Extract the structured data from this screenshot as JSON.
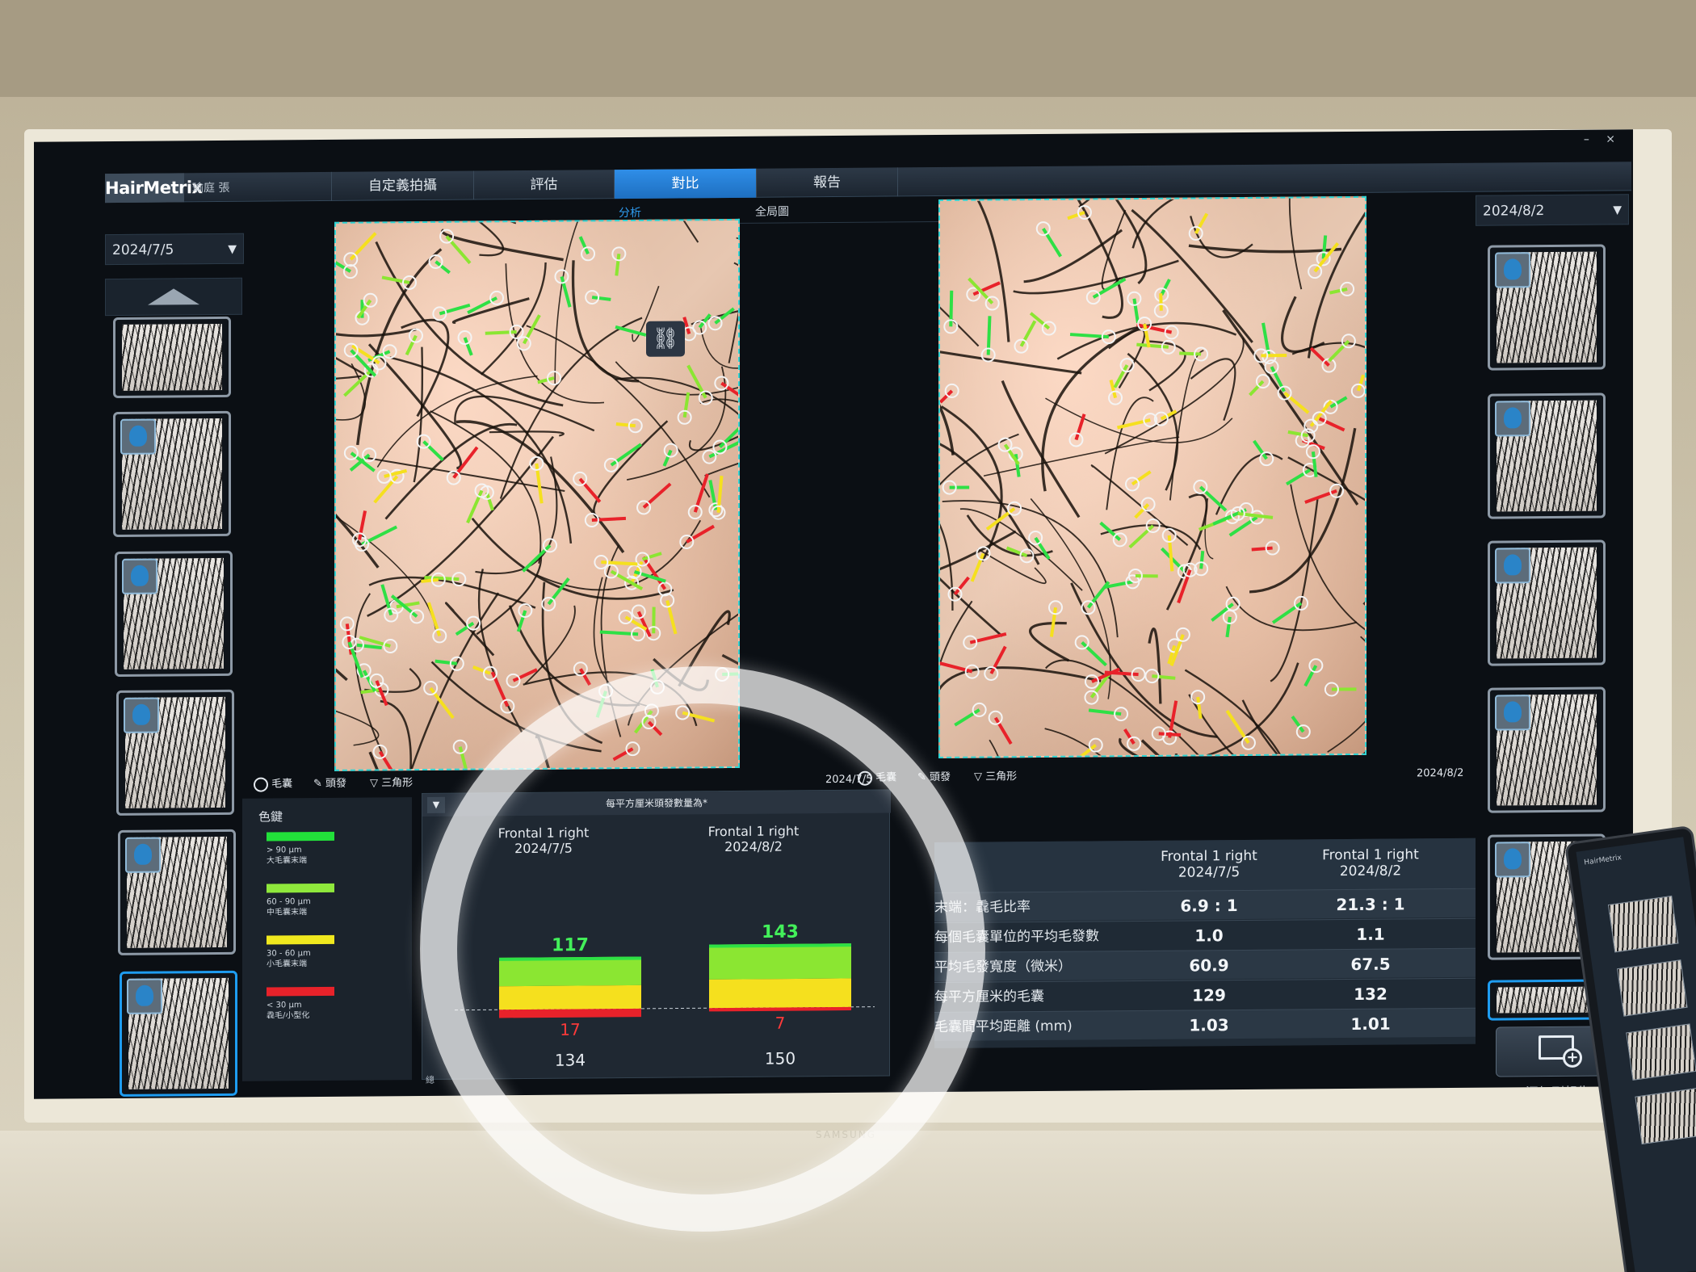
{
  "app": {
    "logo": "HairMetrix",
    "user": "瑜庭 張",
    "window_controls": "– ×"
  },
  "tabs": [
    {
      "label": "自定義拍攝",
      "active": false
    },
    {
      "label": "評估",
      "active": false
    },
    {
      "label": "對比",
      "active": true
    },
    {
      "label": "報告",
      "active": false
    }
  ],
  "subtabs": [
    {
      "label": "分析",
      "active": true
    },
    {
      "label": "全局圖",
      "active": false
    }
  ],
  "left": {
    "date_select": "2024/7/5",
    "image_date": "2024/7/5"
  },
  "right": {
    "date_select": "2024/8/2",
    "image_date": "2024/8/2"
  },
  "image_toolbar": {
    "follicle": "毛囊",
    "hair": "頭發",
    "triangle": "三角形"
  },
  "legend": {
    "title": "色鍵",
    "items": [
      {
        "color": "#22e03a",
        "range": "> 90 µm",
        "desc": "大毛囊末端"
      },
      {
        "color": "#8fe83c",
        "range": "60 - 90 µm",
        "desc": "中毛囊末端"
      },
      {
        "color": "#f0e81e",
        "range": "30 - 60 µm",
        "desc": "小毛囊末端"
      },
      {
        "color": "#e8222a",
        "range": "< 30 µm",
        "desc": "毳毛/小型化"
      }
    ]
  },
  "chart": {
    "header": "每平方厘米頭發數量為*",
    "total_prefix": "總",
    "colors": {
      "green": "#2ee045",
      "lime": "#8be632",
      "yellow": "#f5e01e",
      "red": "#e8222a"
    }
  },
  "chart_data": {
    "type": "bar",
    "categories": [
      "Frontal 1 right\n2024/7/5",
      "Frontal 1 right\n2024/8/2"
    ],
    "series": [
      {
        "name": "top",
        "values": [
          117,
          143
        ]
      },
      {
        "name": "bottom",
        "values": [
          17,
          7
        ]
      },
      {
        "name": "total",
        "values": [
          134,
          150
        ]
      }
    ]
  },
  "chart_cols": [
    {
      "title_line1": "Frontal 1 right",
      "title_line2": "2024/7/5",
      "top": "117",
      "bottom": "17",
      "total": "134"
    },
    {
      "title_line1": "Frontal 1 right",
      "title_line2": "2024/8/2",
      "top": "143",
      "bottom": "7",
      "total": "150"
    }
  ],
  "stats": {
    "columns": [
      {
        "line1": "Frontal 1 right",
        "line2": "2024/7/5"
      },
      {
        "line1": "Frontal 1 right",
        "line2": "2024/8/2"
      }
    ],
    "rows": [
      {
        "label": "末端：毳毛比率",
        "a": "6.9 : 1",
        "b": "21.3 : 1"
      },
      {
        "label": "每個毛囊單位的平均毛發數",
        "a": "1.0",
        "b": "1.1"
      },
      {
        "label": "平均毛發寬度（微米）",
        "a": "60.9",
        "b": "67.5"
      },
      {
        "label": "每平方厘米的毛囊",
        "a": "129",
        "b": "132"
      },
      {
        "label": "毛囊間平均距離 (mm)",
        "a": "1.03",
        "b": "1.01"
      }
    ]
  },
  "add_report": "添加到報告",
  "bezel_brand": "SAMSUNG"
}
